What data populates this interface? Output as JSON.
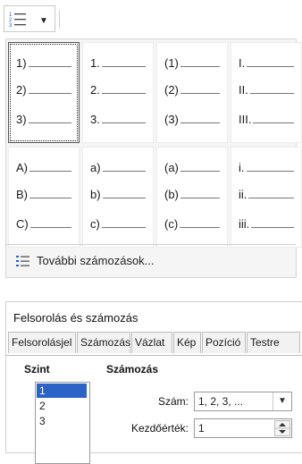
{
  "toolbar": {
    "numbering_button_icon": "ordered-list-icon",
    "dropdown_icon": "caret-down-icon"
  },
  "gallery": {
    "presets": [
      {
        "lines": [
          "1)",
          "2)",
          "3)"
        ],
        "selected": true
      },
      {
        "lines": [
          "1.",
          "2.",
          "3."
        ],
        "selected": false
      },
      {
        "lines": [
          "(1)",
          "(2)",
          "(3)"
        ],
        "selected": false
      },
      {
        "lines": [
          "I.",
          "II.",
          "III."
        ],
        "selected": false
      },
      {
        "lines": [
          "A)",
          "B)",
          "C)"
        ],
        "selected": false
      },
      {
        "lines": [
          "a)",
          "b)",
          "c)"
        ],
        "selected": false
      },
      {
        "lines": [
          "(a)",
          "(b)",
          "(c)"
        ],
        "selected": false
      },
      {
        "lines": [
          "i.",
          "ii.",
          "iii."
        ],
        "selected": false
      }
    ],
    "more_label": "További számozások...",
    "more_icon": "list-settings-icon"
  },
  "dialog": {
    "title": "Felsorolás és számozás",
    "tabs": [
      "Felsorolásjel",
      "Számozás",
      "Vázlat",
      "Kép",
      "Pozíció",
      "Testre"
    ],
    "level_heading": "Szint",
    "levels": [
      "1",
      "2",
      "3"
    ],
    "selected_level": "1",
    "numbering_heading": "Számozás",
    "number_label": "Szám:",
    "number_value": "1, 2, 3, ...",
    "start_label": "Kezdőérték:",
    "start_value": "1"
  }
}
